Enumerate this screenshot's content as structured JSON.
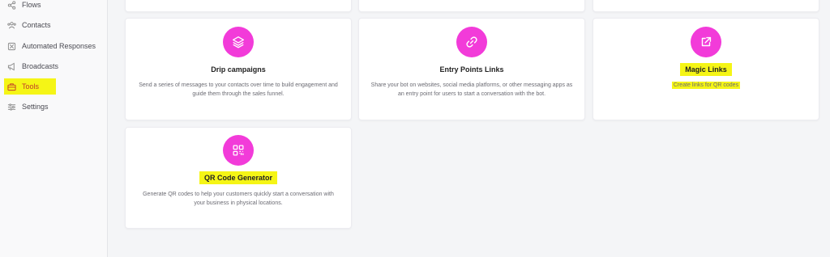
{
  "sidebar": {
    "items": [
      {
        "label": "Flows",
        "icon": "flows-icon",
        "active": false
      },
      {
        "label": "Contacts",
        "icon": "contacts-icon",
        "active": false
      },
      {
        "label": "Automated Responses",
        "icon": "automated-responses-icon",
        "active": false
      },
      {
        "label": "Broadcasts",
        "icon": "megaphone-icon",
        "active": false
      },
      {
        "label": "Tools",
        "icon": "toolbox-icon",
        "active": true
      },
      {
        "label": "Settings",
        "icon": "sliders-icon",
        "active": false
      }
    ]
  },
  "cards": [
    {
      "title": "Drip campaigns",
      "description": "Send a series of messages to your contacts over time to build engagement and guide them through the sales funnel.",
      "icon": "layers-icon"
    },
    {
      "title": "Entry Points Links",
      "description": "Share your bot on websites, social media platforms, or other messaging apps as an entry point for users to start a conversation with the bot.",
      "icon": "link-icon"
    },
    {
      "title": "Magic Links",
      "description": "Create links for QR codes",
      "icon": "external-link-icon"
    },
    {
      "title": "QR Code Generator",
      "description": "Generate QR codes to help your customers quickly start a conversation with your business in physical locations.",
      "icon": "qr-code-icon"
    }
  ],
  "colors": {
    "accent": "#f23bd9",
    "highlight": "#f5f516",
    "active_text": "#c0392b"
  }
}
